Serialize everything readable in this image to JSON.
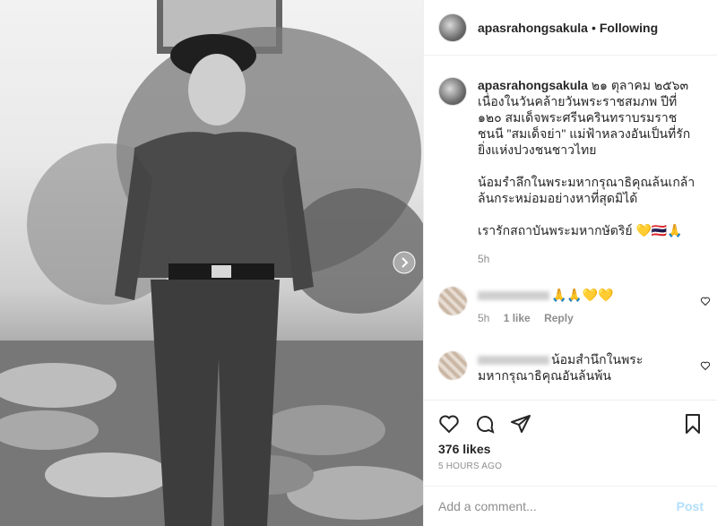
{
  "post": {
    "username": "apasrahongsakula",
    "following_label": "Following",
    "caption": {
      "date": "๒๑ ตุลาคม ๒๕๖๓",
      "line1": "เนื่องในวันคล้ายวันพระราชสมภพ ปีที่ ๑๒๐ สมเด็จพระศรีนครินทราบรมราชชนนี \"สมเด็จย่า\" แม่ฟ้าหลวงอันเป็นที่รักยิ่งแห่งปวงชนชาวไทย",
      "line2": "น้อมรำลึกในพระมหากรุณาธิคุณล้นเกล้าล้นกระหม่อมอย่างหาที่สุดมิได้",
      "line3": "เรารักสถาบันพระมหากษัตริย์ 💛🇹🇭🙏",
      "age": "5h"
    },
    "comments": [
      {
        "text": "🙏🙏💛💛",
        "age": "5h",
        "likes": "1 like",
        "reply": "Reply"
      },
      {
        "text": "น้อมสำนึกในพระมหากรุณาธิคุณอันล้นพ้น"
      }
    ],
    "likes": "376 likes",
    "time": "5 HOURS AGO",
    "add_comment_placeholder": "Add a comment...",
    "post_label": "Post",
    "icons": [
      "heart-icon",
      "comment-icon",
      "share-icon",
      "bookmark-icon",
      "next-arrow-icon"
    ]
  }
}
